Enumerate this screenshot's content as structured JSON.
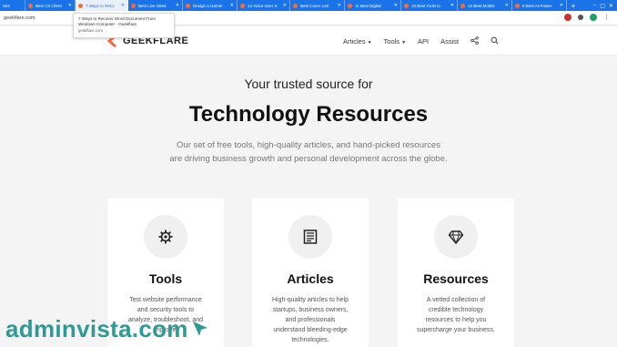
{
  "browser": {
    "tabs": [
      {
        "label": "Ses"
      },
      {
        "label": "Best Git Client"
      },
      {
        "label": "7 Ways to Reco"
      },
      {
        "label": "Best Live Strea"
      },
      {
        "label": "Design a Gamer"
      },
      {
        "label": "14 Voice Over S"
      },
      {
        "label": "Best Cover Lett"
      },
      {
        "label": "11 Best Digital"
      },
      {
        "label": "10 Best Tools to"
      },
      {
        "label": "12 Best Mobile"
      },
      {
        "label": "9 Best AI-Power"
      }
    ],
    "new_tab_label": "+",
    "url": "geekflare.com",
    "tooltip": {
      "title": "7 Ways to Recover Word Document From Windows Computer - Geekflare",
      "domain": "geekflare.com"
    },
    "colors": {
      "tabstrip": "#1a73e8",
      "favicon": "#f46c3b"
    }
  },
  "site": {
    "logo_text": "GEEKFLARE",
    "nav": {
      "articles": "Articles",
      "tools": "Tools",
      "api": "API",
      "assist": "Assist"
    },
    "hero": {
      "subheading": "Your trusted source for",
      "heading": "Technology Resources",
      "description_line1": "Our set of free tools, high-quality articles, and hand-picked resources",
      "description_line2": "are driving business growth and personal development across the globe."
    },
    "cards": [
      {
        "icon": "gear-icon",
        "title": "Tools",
        "lines": [
          "Test website performance",
          "and security tools to",
          "analyze, troubleshoot, and",
          "improve."
        ]
      },
      {
        "icon": "document-icon",
        "title": "Articles",
        "lines": [
          "High-quality articles to help",
          "startups, business owners,",
          "and professionals",
          "understand bleeding-edge",
          "technologies."
        ]
      },
      {
        "icon": "diamond-icon",
        "title": "Resources",
        "lines": [
          "A vetted collection of",
          "credible technology",
          "resources to help you",
          "supercharge your business."
        ]
      }
    ]
  },
  "watermark": {
    "text": "adminvista.com",
    "color": "#2f9a93"
  }
}
